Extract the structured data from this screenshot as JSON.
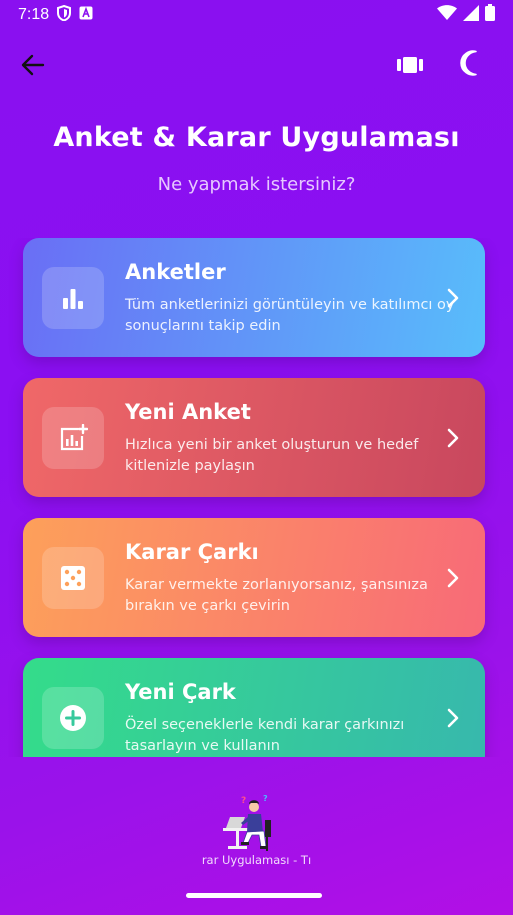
{
  "status": {
    "time": "7:18",
    "icons": [
      "shield-icon",
      "font-a-icon",
      "wifi-icon",
      "signal-icon",
      "battery-icon"
    ]
  },
  "header": {
    "back_icon": "arrow-left-icon",
    "theme_icon": "carousel-icon",
    "mode_icon": "moon-icon"
  },
  "title": "Anket & Karar Uygulaması",
  "subtitle": "Ne yapmak istersiniz?",
  "cards": [
    {
      "title": "Anketler",
      "desc": "Tüm anketlerinizi görüntüleyin ve katılımcı oy sonuçlarını takip edin",
      "icon": "bar-chart-icon",
      "colors": [
        "#6a6ef5",
        "#58bdfb"
      ]
    },
    {
      "title": "Yeni Anket",
      "desc": "Hızlıca yeni bir anket oluşturun ve hedef kitlenizle paylaşın",
      "icon": "add-chart-icon",
      "colors": [
        "#f06868",
        "#c8475e"
      ]
    },
    {
      "title": "Karar Çarkı",
      "desc": "Karar vermekte zorlanıyorsanız, şansınıza bırakın ve çarkı çevirin",
      "icon": "dice-icon",
      "colors": [
        "#fda05a",
        "#f86a78"
      ]
    },
    {
      "title": "Yeni Çark",
      "desc": "Özel seçeneklerle kendi karar çarkınızı tasarlayın ve kullanın",
      "icon": "add-circle-icon",
      "colors": [
        "#34dc8a",
        "#37b8ad"
      ]
    }
  ],
  "footer": {
    "text": "rar Uygulaması - Tı",
    "illustration": "person-with-laptop-illustration"
  }
}
